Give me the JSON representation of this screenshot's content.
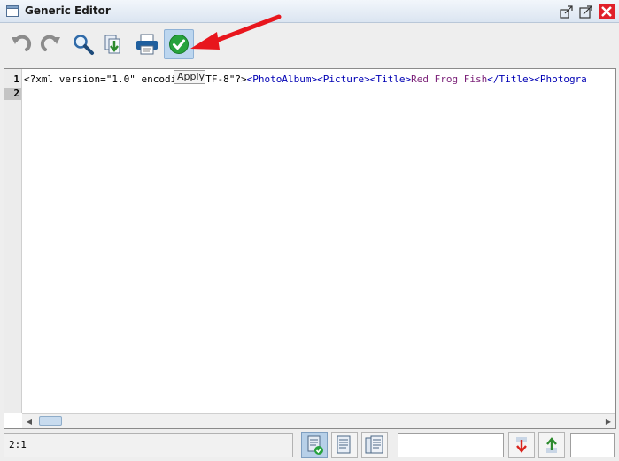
{
  "window": {
    "title": "Generic Editor",
    "app_icon": "window-icon",
    "controls": [
      "restore-icon",
      "maximize-icon",
      "close-icon"
    ],
    "close_color": "#e0202a"
  },
  "toolbar": {
    "buttons": [
      {
        "name": "undo",
        "icon": "undo-icon"
      },
      {
        "name": "redo",
        "icon": "redo-icon"
      },
      {
        "name": "find",
        "icon": "search-icon"
      },
      {
        "name": "import",
        "icon": "import-document-icon"
      },
      {
        "name": "print",
        "icon": "printer-icon"
      },
      {
        "name": "apply",
        "icon": "check-circle-icon",
        "active": true
      }
    ],
    "tooltip": "Apply"
  },
  "editor": {
    "line_numbers": [
      "1",
      "2"
    ],
    "current_line": "2",
    "tokens": [
      {
        "text": "<?xml version=\"1.0\" encoding=\"UTF-8\"?>",
        "kind": "plain"
      },
      {
        "text": "<PhotoAlbum>",
        "kind": "tag"
      },
      {
        "text": "<Picture>",
        "kind": "tag"
      },
      {
        "text": "<Title>",
        "kind": "tag"
      },
      {
        "text": "Red Frog Fish",
        "kind": "text"
      },
      {
        "text": "</Title>",
        "kind": "tag"
      },
      {
        "text": "<Photogra",
        "kind": "tag"
      }
    ],
    "colors": {
      "plain": "#000000",
      "tag": "#0000b4",
      "text": "#7a1f77"
    }
  },
  "status": {
    "caret_position": "2:1"
  },
  "annotation": {
    "arrow_color": "#e8161d"
  }
}
